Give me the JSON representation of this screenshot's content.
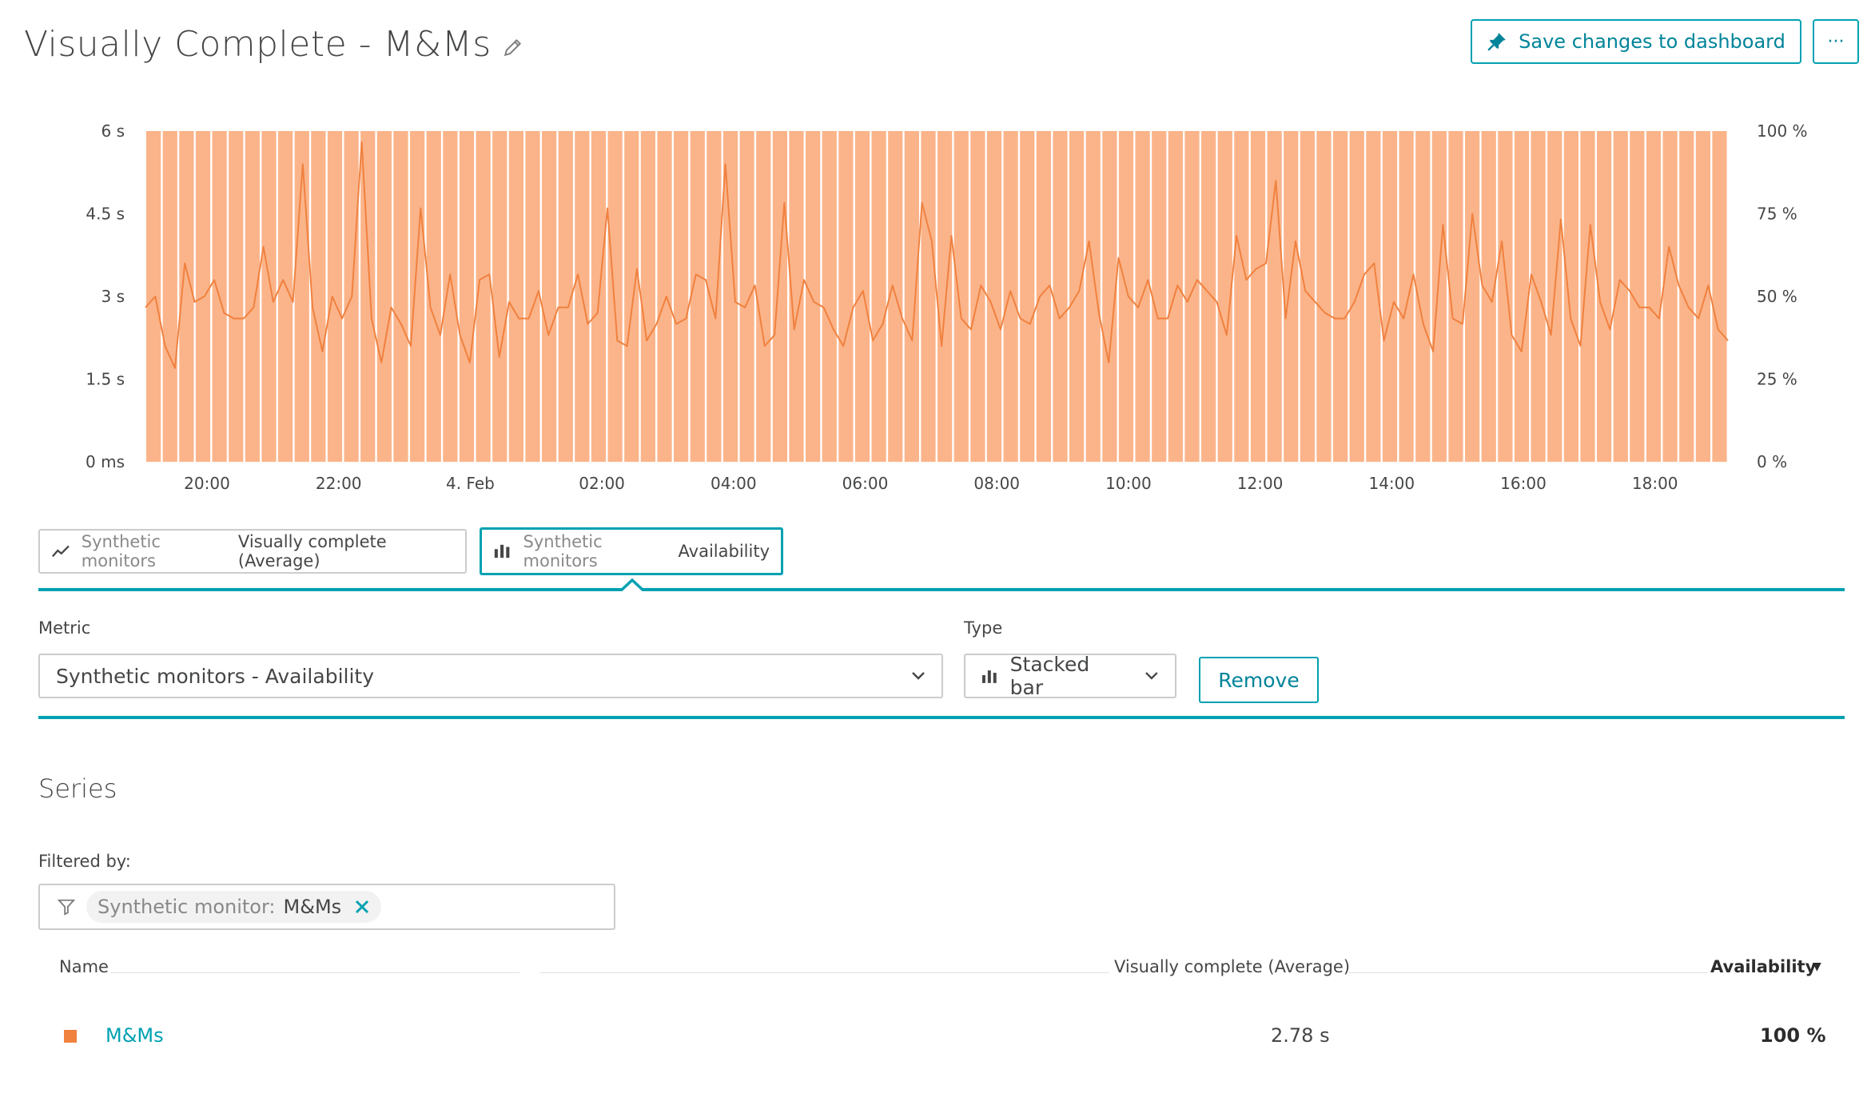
{
  "header": {
    "title": "Visually Complete - M&Ms",
    "save_label": "Save changes to dashboard",
    "more_label": "···"
  },
  "chart_data": {
    "type": "bar",
    "title": "",
    "left_axis": {
      "ticks": [
        "0 ms",
        "1.5 s",
        "3 s",
        "4.5 s",
        "6 s"
      ],
      "ylim": [
        0,
        6
      ],
      "unit": "s"
    },
    "right_axis": {
      "ticks": [
        "0 %",
        "25 %",
        "50 %",
        "75 %",
        "100 %"
      ],
      "ylim": [
        0,
        100
      ],
      "unit": "%"
    },
    "x_ticks": [
      "20:00",
      "22:00",
      "4. Feb",
      "02:00",
      "04:00",
      "06:00",
      "08:00",
      "10:00",
      "12:00",
      "14:00",
      "16:00",
      "18:00"
    ],
    "colors": {
      "bar": "#fbb48a",
      "line": "#f0813f"
    },
    "series": [
      {
        "name": "Availability",
        "kind": "stacked bar",
        "axis": "right",
        "bar_count": 96,
        "value_each": 100
      },
      {
        "name": "Visually complete (Average)",
        "kind": "line",
        "axis": "left",
        "values": [
          2.8,
          3.0,
          2.1,
          1.7,
          3.6,
          2.9,
          3.0,
          3.3,
          2.7,
          2.6,
          2.6,
          2.8,
          3.9,
          2.9,
          3.3,
          2.9,
          5.4,
          2.8,
          2.0,
          3.0,
          2.6,
          3.0,
          5.8,
          2.6,
          1.8,
          2.8,
          2.5,
          2.1,
          4.6,
          2.8,
          2.3,
          3.4,
          2.3,
          1.8,
          3.3,
          3.4,
          1.9,
          2.9,
          2.6,
          2.6,
          3.1,
          2.3,
          2.8,
          2.8,
          3.4,
          2.5,
          2.7,
          4.6,
          2.2,
          2.1,
          3.5,
          2.2,
          2.5,
          3.0,
          2.5,
          2.6,
          3.4,
          3.3,
          2.6,
          5.4,
          2.9,
          2.8,
          3.2,
          2.1,
          2.3,
          4.7,
          2.4,
          3.3,
          2.9,
          2.8,
          2.4,
          2.1,
          2.8,
          3.1,
          2.2,
          2.5,
          3.2,
          2.6,
          2.2,
          4.7,
          4.0,
          2.1,
          4.1,
          2.6,
          2.4,
          3.2,
          2.9,
          2.4,
          3.1,
          2.6,
          2.5,
          3.0,
          3.2,
          2.6,
          2.8,
          3.1,
          4.0,
          2.7,
          1.8,
          3.7,
          3.0,
          2.8,
          3.3,
          2.6,
          2.6,
          3.2,
          2.9,
          3.3,
          3.1,
          2.9,
          2.3,
          4.1,
          3.3,
          3.5,
          3.6,
          5.1,
          2.6,
          4.0,
          3.1,
          2.9,
          2.7,
          2.6,
          2.6,
          2.9,
          3.4,
          3.6,
          2.2,
          2.9,
          2.6,
          3.4,
          2.5,
          2.0,
          4.3,
          2.6,
          2.5,
          4.5,
          3.2,
          2.9,
          4.0,
          2.3,
          2.0,
          3.4,
          2.9,
          2.3,
          4.4,
          2.6,
          2.1,
          4.3,
          2.9,
          2.4,
          3.3,
          3.1,
          2.8,
          2.8,
          2.6,
          3.9,
          3.2,
          2.8,
          2.6,
          3.2,
          2.4,
          2.2
        ]
      }
    ]
  },
  "metric_tabs": [
    {
      "category": "Synthetic monitors",
      "name": "Visually complete (Average)",
      "icon": "line-chart-icon"
    },
    {
      "category": "Synthetic monitors",
      "name": "Availability",
      "icon": "bar-chart-icon"
    }
  ],
  "config": {
    "metric_label": "Metric",
    "metric_value": "Synthetic monitors - Availability",
    "type_label": "Type",
    "type_value": "Stacked bar",
    "remove_label": "Remove"
  },
  "series": {
    "title": "Series",
    "filtered_by_label": "Filtered by:",
    "filter_key": "Synthetic monitor:",
    "filter_value": "M&Ms"
  },
  "table": {
    "col_name": "Name",
    "col_vc": "Visually complete (Average)",
    "col_avail": "Availability",
    "sort_indicator": "▼",
    "rows": [
      {
        "name": "M&Ms",
        "vc": "2.78 s",
        "avail": "100 %",
        "color": "#f0813f"
      }
    ]
  }
}
